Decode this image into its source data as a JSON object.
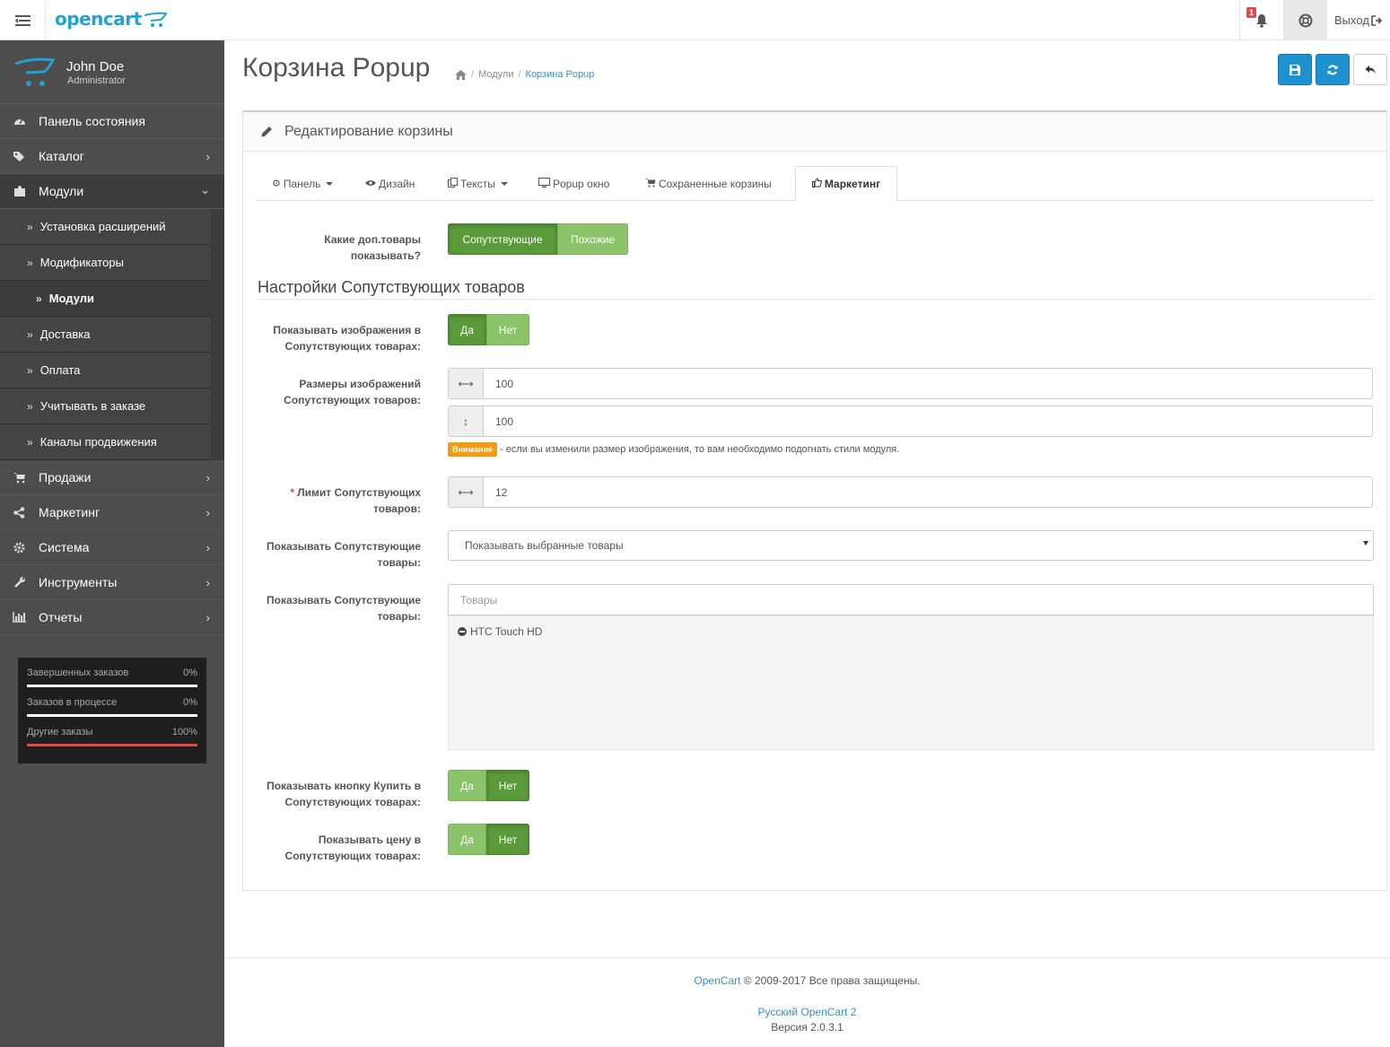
{
  "header": {
    "logo_text": "opencart",
    "notifications_count": "1",
    "logout_label": "Выход"
  },
  "profile": {
    "name": "John Doe",
    "role": "Administrator"
  },
  "sidebar": {
    "items": [
      {
        "label": "Панель состояния",
        "icon": "dashboard-icon"
      },
      {
        "label": "Каталог",
        "icon": "tags-icon"
      },
      {
        "label": "Модули",
        "icon": "puzzle-icon"
      },
      {
        "label": "Продажи",
        "icon": "cart-icon"
      },
      {
        "label": "Маркетинг",
        "icon": "share-icon"
      },
      {
        "label": "Система",
        "icon": "gear-icon"
      },
      {
        "label": "Инструменты",
        "icon": "wrench-icon"
      },
      {
        "label": "Отчеты",
        "icon": "bar-chart-icon"
      }
    ],
    "sub_items": [
      "Установка расширений",
      "Модификаторы",
      "Модули",
      "Доставка",
      "Оплата",
      "Учитывать в заказе",
      "Каналы продвижения"
    ]
  },
  "stats": [
    {
      "label": "Завершенных заказов",
      "value": "0%",
      "fraction": 0.0
    },
    {
      "label": "Заказов в процессе",
      "value": "0%",
      "fraction": 0.0
    },
    {
      "label": "Другие заказы",
      "value": "100%",
      "fraction": 1.0
    }
  ],
  "page": {
    "title": "Корзина Popup",
    "breadcrumb": [
      "Модули",
      "Корзина Popup"
    ]
  },
  "panel": {
    "heading": "Редактирование корзины"
  },
  "tabs": [
    {
      "label": "Панель",
      "dropdown": true,
      "icon": "gear-icon"
    },
    {
      "label": "Дизайн",
      "dropdown": false,
      "icon": "eye-icon"
    },
    {
      "label": "Тексты",
      "dropdown": true,
      "icon": "pages-icon"
    },
    {
      "label": "Popup окно",
      "dropdown": false,
      "icon": "monitor-icon"
    },
    {
      "label": "Сохраненные корзины",
      "dropdown": false,
      "icon": "cart-icon"
    },
    {
      "label": "Маркетинг",
      "dropdown": false,
      "icon": "thumbs-up-icon",
      "active": true
    }
  ],
  "form": {
    "which_label": "Какие доп.товары показывать?",
    "which_options": [
      "Сопутствующие",
      "Похожие"
    ],
    "section_title": "Настройки Сопутствующих товаров",
    "show_images_label": "Показывать изображения в Сопутствующих товарах:",
    "yes": "Да",
    "no": "Нет",
    "image_size_label": "Размеры изображений Сопутствующих товаров:",
    "image_width": "100",
    "image_height": "100",
    "warning_badge": "Внимание",
    "warning_text": "- если вы изменили размер изображения, то вам необходимо подогнать стили модуля.",
    "limit_required": "*",
    "limit_label": "Лимит Сопутствующих товаров:",
    "limit_value": "12",
    "show_mode_label": "Показывать Сопутствующие товары:",
    "show_mode_value": "Показывать выбранные товары",
    "products_label": "Показывать Сопутствующие товары:",
    "products_placeholder": "Товары",
    "selected_products": [
      "HTC Touch HD"
    ],
    "buy_button_label": "Показывать кнопку Купить в Сопутствующих товарах:",
    "price_label": "Показывать цену в Сопутствующих товарах:"
  },
  "footer": {
    "brand": "OpenCart",
    "copyright": "© 2009-2017 Все права защищены.",
    "ru_link": "Русский OpenCart 2",
    "version": "Версия 2.0.3.1"
  },
  "colors": {
    "primary": "#1e91cf",
    "toggle_on": "#5b9a3b",
    "toggle_off": "#8bc36a",
    "warning": "#f39c12",
    "sidebar": "#4d4d4d"
  }
}
